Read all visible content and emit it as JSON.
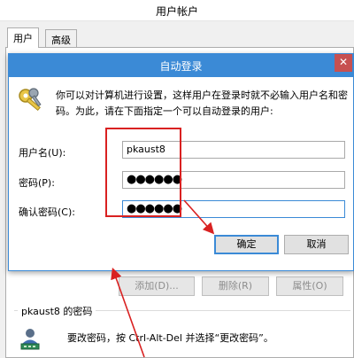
{
  "outer_window": {
    "title": "用户帐户",
    "tabs": [
      {
        "label": "用户",
        "active": true
      },
      {
        "label": "高级",
        "active": false
      }
    ],
    "buttons": {
      "add": "添加(D)...",
      "remove": "删除(R)",
      "properties": "属性(O)"
    },
    "password_group": {
      "title": "pkaust8 的密码",
      "text": "要改密码，按 Ctrl-Alt-Del 并选择“更改密码”。"
    }
  },
  "dialog": {
    "title": "自动登录",
    "close_glyph": "✕",
    "description": "你可以对计算机进行设置，这样用户在登录时就不必输入用户名和密码。为此，请在下面指定一个可以自动登录的用户:",
    "fields": {
      "username_label": "用户名(U):",
      "username_value": "pkaust8",
      "password_label": "密码(P):",
      "password_value": "●●●●●●",
      "confirm_label": "确认密码(C):",
      "confirm_value": "●●●●●●"
    },
    "buttons": {
      "ok": "确定",
      "cancel": "取消"
    }
  },
  "icons": {
    "dialog_icon": "keys-icon",
    "close": "close-icon",
    "password_group_icon": "user-keyboard-icon"
  },
  "colors": {
    "dialog_title_bar": "#3b8ad6",
    "close_button": "#c75050",
    "annotation": "#d92121"
  }
}
